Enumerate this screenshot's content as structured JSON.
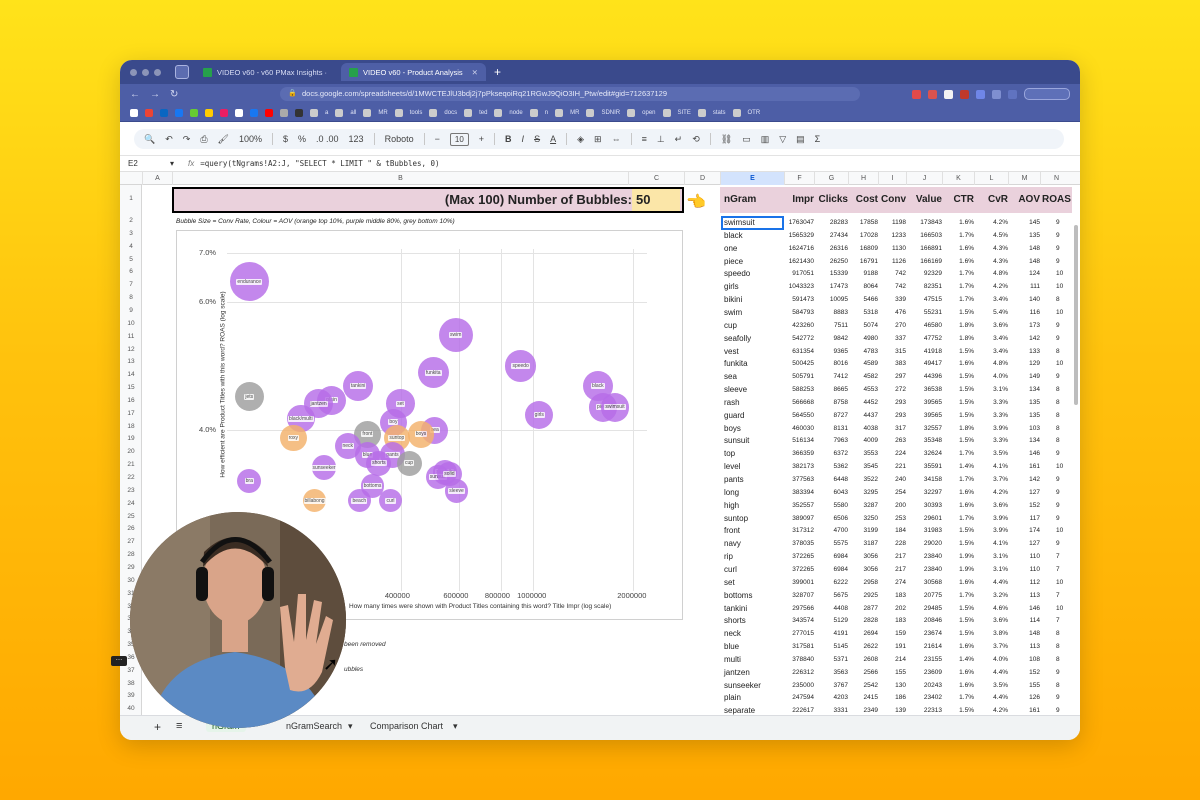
{
  "browser": {
    "tabs": [
      {
        "label": "VIDEO v60 - v60 PMax Insights ·",
        "active": false
      },
      {
        "label": "VIDEO v60 - Product Analysis",
        "active": true
      }
    ],
    "url": "docs.google.com/spreadsheets/d/1MWCTEJlU3bdj2j7pPkseqoiRq21RGwJ9QiO3IH_Ptw/edit#gid=712637129",
    "bookmarks": [
      "a",
      "all",
      "MR",
      "tools",
      "docs",
      "ted",
      "node",
      "n",
      "MR",
      "SDNIR",
      "open",
      "SITE",
      "stats",
      "OTR"
    ]
  },
  "toolbar": {
    "zoom": "100%",
    "currency": "$",
    "percent": "%",
    "decimals": ".0 .00",
    "format123": "123",
    "font": "Roboto",
    "font_size": "10",
    "minus": "−",
    "plus": "+",
    "bold": "B",
    "italic": "I",
    "strike": "S",
    "text_color": "A",
    "sigma": "Σ"
  },
  "formula_bar": {
    "cell": "E2",
    "fx": "fx",
    "formula": "=query(tNgrams!A2:J, \"SELECT * LIMIT \" & tBubbles, 0)"
  },
  "columns": [
    "A",
    "B",
    "C",
    "D",
    "E",
    "F",
    "G",
    "H",
    "I",
    "J",
    "K",
    "L",
    "M",
    "N"
  ],
  "row_numbers": [
    "1",
    "2",
    "3",
    "4",
    "5",
    "6",
    "7",
    "8",
    "9",
    "10",
    "11",
    "12",
    "13",
    "14",
    "15",
    "16",
    "17",
    "18",
    "19",
    "20",
    "21",
    "22",
    "23",
    "24",
    "25",
    "26",
    "27",
    "28",
    "29",
    "30",
    "31",
    "32",
    "33",
    "34",
    "35",
    "36",
    "37",
    "38",
    "39",
    "40"
  ],
  "sheet_header": {
    "label": "(Max 100) Number of Bubbles:",
    "value": "50",
    "caption": "Bubble Size = Conv Rate, Colour = AOV (orange top 10%, purple middle 80%, grey bottom 10%)"
  },
  "chart_data": {
    "type": "scatter",
    "ylabel": "How efficient are Product Titles with this word? ROAS (log scale)",
    "xlabel": "How many times were shown with Product Titles containing this word? Title Impr  (log scale)",
    "y_ticks": [
      "7.0%",
      "6.0%",
      "4.0%"
    ],
    "x_ticks": [
      "400000",
      "600000",
      "800000",
      "1000000",
      "2000000"
    ],
    "x_scale": "log",
    "y_scale": "log",
    "colors": {
      "purple": "#b76de8",
      "orange": "#f4b26b",
      "grey": "#9e9e9e"
    },
    "points": [
      {
        "label": "endurance",
        "color": "purple",
        "x": 140000,
        "y": 6.4
      },
      {
        "label": "swim",
        "color": "purple",
        "x": 584793,
        "y": 5.4
      },
      {
        "label": "speedo",
        "color": "purple",
        "x": 917051,
        "y": 4.9
      },
      {
        "label": "black",
        "color": "purple",
        "x": 1565329,
        "y": 4.6
      },
      {
        "label": "piece",
        "color": "purple",
        "x": 1621430,
        "y": 4.3
      },
      {
        "label": "swimsuit",
        "color": "purple",
        "x": 1763047,
        "y": 4.3
      },
      {
        "label": "girls",
        "color": "purple",
        "x": 1043323,
        "y": 4.2
      },
      {
        "label": "funkita",
        "color": "purple",
        "x": 500425,
        "y": 4.8
      },
      {
        "label": "tankini",
        "color": "purple",
        "x": 297566,
        "y": 4.6
      },
      {
        "label": "jets",
        "color": "grey",
        "x": 140000,
        "y": 4.45
      },
      {
        "label": "plain",
        "color": "purple",
        "x": 247594,
        "y": 4.4
      },
      {
        "label": "jantzen",
        "color": "purple",
        "x": 226312,
        "y": 4.35
      },
      {
        "label": "black/multi",
        "color": "purple",
        "x": 200000,
        "y": 4.15
      },
      {
        "label": "set",
        "color": "purple",
        "x": 399001,
        "y": 4.35
      },
      {
        "label": "sea",
        "color": "purple",
        "x": 505791,
        "y": 4.0
      },
      {
        "label": "roxy",
        "color": "orange",
        "x": 190000,
        "y": 3.9
      },
      {
        "label": "boy",
        "color": "purple",
        "x": 380000,
        "y": 4.1
      },
      {
        "label": "front",
        "color": "grey",
        "x": 317312,
        "y": 3.95
      },
      {
        "label": "boys",
        "color": "orange",
        "x": 460030,
        "y": 3.95
      },
      {
        "label": "suntop",
        "color": "orange",
        "x": 389097,
        "y": 3.9
      },
      {
        "label": "neck",
        "color": "purple",
        "x": 277015,
        "y": 3.8
      },
      {
        "label": "blue",
        "color": "purple",
        "x": 317581,
        "y": 3.7
      },
      {
        "label": "pants",
        "color": "purple",
        "x": 377563,
        "y": 3.7
      },
      {
        "label": "shorts",
        "color": "purple",
        "x": 343574,
        "y": 3.6
      },
      {
        "label": "cup",
        "color": "grey",
        "x": 423260,
        "y": 3.6
      },
      {
        "label": "sunseeker",
        "color": "purple",
        "x": 235000,
        "y": 3.55
      },
      {
        "label": "seafolly",
        "color": "purple",
        "x": 542772,
        "y": 3.5
      },
      {
        "label": "sunsuit",
        "color": "purple",
        "x": 516134,
        "y": 3.45
      },
      {
        "label": "solid",
        "color": "purple",
        "x": 560000,
        "y": 3.48
      },
      {
        "label": "bra",
        "color": "purple",
        "x": 140000,
        "y": 3.4
      },
      {
        "label": "bottoms",
        "color": "purple",
        "x": 328707,
        "y": 3.35
      },
      {
        "label": "curl",
        "color": "purple",
        "x": 372265,
        "y": 3.2
      },
      {
        "label": "sleeve",
        "color": "purple",
        "x": 588253,
        "y": 3.3
      },
      {
        "label": "beach",
        "color": "purple",
        "x": 300000,
        "y": 3.2
      },
      {
        "label": "billabong",
        "color": "orange",
        "x": 220000,
        "y": 3.2
      }
    ]
  },
  "chart_notes": {
    "note1": "been removed",
    "note2": "ubbles"
  },
  "table": {
    "headers": [
      "nGram",
      "Impr",
      "Clicks",
      "Cost",
      "Conv",
      "Value",
      "CTR",
      "CvR",
      "AOV",
      "ROAS"
    ],
    "rows": [
      [
        "swimsuit",
        "1763047",
        "28283",
        "17858",
        "1198",
        "173843",
        "1.6%",
        "4.2%",
        "145",
        "9"
      ],
      [
        "black",
        "1565329",
        "27434",
        "17028",
        "1233",
        "166503",
        "1.7%",
        "4.5%",
        "135",
        "9"
      ],
      [
        "one",
        "1624716",
        "26316",
        "16809",
        "1130",
        "166891",
        "1.6%",
        "4.3%",
        "148",
        "9"
      ],
      [
        "piece",
        "1621430",
        "26250",
        "16791",
        "1126",
        "166169",
        "1.6%",
        "4.3%",
        "148",
        "9"
      ],
      [
        "speedo",
        "917051",
        "15339",
        "9188",
        "742",
        "92329",
        "1.7%",
        "4.8%",
        "124",
        "10"
      ],
      [
        "girls",
        "1043323",
        "17473",
        "8064",
        "742",
        "82351",
        "1.7%",
        "4.2%",
        "111",
        "10"
      ],
      [
        "bikini",
        "591473",
        "10095",
        "5466",
        "339",
        "47515",
        "1.7%",
        "3.4%",
        "140",
        "8"
      ],
      [
        "swim",
        "584793",
        "8883",
        "5318",
        "476",
        "55231",
        "1.5%",
        "5.4%",
        "116",
        "10"
      ],
      [
        "cup",
        "423260",
        "7511",
        "5074",
        "270",
        "46580",
        "1.8%",
        "3.6%",
        "173",
        "9"
      ],
      [
        "seafolly",
        "542772",
        "9842",
        "4980",
        "337",
        "47752",
        "1.8%",
        "3.4%",
        "142",
        "9"
      ],
      [
        "vest",
        "631354",
        "9365",
        "4783",
        "315",
        "41918",
        "1.5%",
        "3.4%",
        "133",
        "8"
      ],
      [
        "funkita",
        "500425",
        "8016",
        "4589",
        "383",
        "49417",
        "1.6%",
        "4.8%",
        "129",
        "10"
      ],
      [
        "sea",
        "505791",
        "7412",
        "4582",
        "297",
        "44396",
        "1.5%",
        "4.0%",
        "149",
        "9"
      ],
      [
        "sleeve",
        "588253",
        "8665",
        "4553",
        "272",
        "36538",
        "1.5%",
        "3.1%",
        "134",
        "8"
      ],
      [
        "rash",
        "566668",
        "8758",
        "4452",
        "293",
        "39565",
        "1.5%",
        "3.3%",
        "135",
        "8"
      ],
      [
        "guard",
        "564550",
        "8727",
        "4437",
        "293",
        "39565",
        "1.5%",
        "3.3%",
        "135",
        "8"
      ],
      [
        "boys",
        "460030",
        "8131",
        "4038",
        "317",
        "32557",
        "1.8%",
        "3.9%",
        "103",
        "8"
      ],
      [
        "sunsuit",
        "516134",
        "7963",
        "4009",
        "263",
        "35348",
        "1.5%",
        "3.3%",
        "134",
        "8"
      ],
      [
        "top",
        "366359",
        "6372",
        "3553",
        "224",
        "32624",
        "1.7%",
        "3.5%",
        "146",
        "9"
      ],
      [
        "level",
        "382173",
        "5362",
        "3545",
        "221",
        "35591",
        "1.4%",
        "4.1%",
        "161",
        "10"
      ],
      [
        "pants",
        "377563",
        "6448",
        "3522",
        "240",
        "34158",
        "1.7%",
        "3.7%",
        "142",
        "9"
      ],
      [
        "long",
        "383394",
        "6043",
        "3295",
        "254",
        "32297",
        "1.6%",
        "4.2%",
        "127",
        "9"
      ],
      [
        "high",
        "352557",
        "5580",
        "3287",
        "200",
        "30393",
        "1.6%",
        "3.6%",
        "152",
        "9"
      ],
      [
        "suntop",
        "389097",
        "6506",
        "3250",
        "253",
        "29601",
        "1.7%",
        "3.9%",
        "117",
        "9"
      ],
      [
        "front",
        "317312",
        "4700",
        "3199",
        "184",
        "31983",
        "1.5%",
        "3.9%",
        "174",
        "10"
      ],
      [
        "navy",
        "378035",
        "5575",
        "3187",
        "228",
        "29020",
        "1.5%",
        "4.1%",
        "127",
        "9"
      ],
      [
        "rip",
        "372265",
        "6984",
        "3056",
        "217",
        "23840",
        "1.9%",
        "3.1%",
        "110",
        "7"
      ],
      [
        "curl",
        "372265",
        "6984",
        "3056",
        "217",
        "23840",
        "1.9%",
        "3.1%",
        "110",
        "7"
      ],
      [
        "set",
        "399001",
        "6222",
        "2958",
        "274",
        "30568",
        "1.6%",
        "4.4%",
        "112",
        "10"
      ],
      [
        "bottoms",
        "328707",
        "5675",
        "2925",
        "183",
        "20775",
        "1.7%",
        "3.2%",
        "113",
        "7"
      ],
      [
        "tankini",
        "297566",
        "4408",
        "2877",
        "202",
        "29485",
        "1.5%",
        "4.6%",
        "146",
        "10"
      ],
      [
        "shorts",
        "343574",
        "5129",
        "2828",
        "183",
        "20846",
        "1.5%",
        "3.6%",
        "114",
        "7"
      ],
      [
        "neck",
        "277015",
        "4191",
        "2694",
        "159",
        "23674",
        "1.5%",
        "3.8%",
        "148",
        "8"
      ],
      [
        "blue",
        "317581",
        "5145",
        "2622",
        "191",
        "21614",
        "1.6%",
        "3.7%",
        "113",
        "8"
      ],
      [
        "multi",
        "378840",
        "5371",
        "2608",
        "214",
        "23155",
        "1.4%",
        "4.0%",
        "108",
        "8"
      ],
      [
        "jantzen",
        "226312",
        "3563",
        "2566",
        "155",
        "23609",
        "1.6%",
        "4.4%",
        "152",
        "9"
      ],
      [
        "sunseeker",
        "235000",
        "3767",
        "2542",
        "130",
        "20243",
        "1.6%",
        "3.5%",
        "155",
        "8"
      ],
      [
        "plain",
        "247594",
        "4203",
        "2415",
        "186",
        "23402",
        "1.7%",
        "4.4%",
        "126",
        "9"
      ],
      [
        "separate",
        "222617",
        "3331",
        "2349",
        "139",
        "22313",
        "1.5%",
        "4.2%",
        "161",
        "9"
      ]
    ]
  },
  "sheet_tabs": [
    {
      "label": "nGram",
      "active": true
    },
    {
      "label": "nGramSearch",
      "active": false
    },
    {
      "label": "Comparison Chart",
      "active": false
    }
  ]
}
